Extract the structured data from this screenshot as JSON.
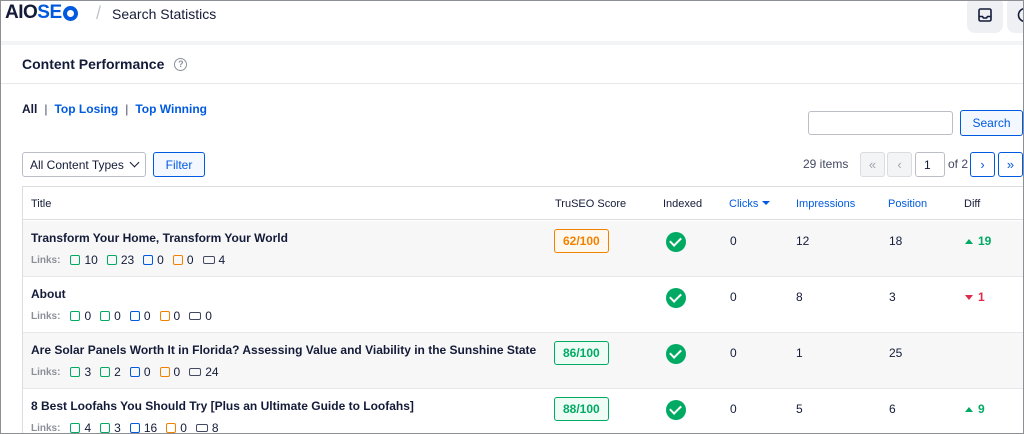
{
  "header": {
    "logo_prefix": "AIO",
    "logo_suffix": "SE",
    "separator": "/",
    "breadcrumb": "Search Statistics"
  },
  "panel": {
    "title": "Content Performance",
    "help_symbol": "?"
  },
  "filters": {
    "all": "All",
    "top_losing": "Top Losing",
    "top_winning": "Top Winning",
    "separator": "|"
  },
  "search": {
    "value": "",
    "button": "Search"
  },
  "content_type": {
    "selected": "All Content Types"
  },
  "filter_button": "Filter",
  "pagination": {
    "items": "29 items",
    "first": "«",
    "prev": "‹",
    "current_page": "1",
    "of_label": "of 2",
    "next": "›",
    "last": "»"
  },
  "table": {
    "columns": {
      "title": "Title",
      "score": "TruSEO Score",
      "indexed": "Indexed",
      "clicks": "Clicks",
      "impressions": "Impressions",
      "position": "Position",
      "diff": "Diff"
    },
    "links_label": "Links:",
    "rows": [
      {
        "title": "Transform Your Home, Transform Your World",
        "links": {
          "internal": "10",
          "outbound": "23",
          "external": "0",
          "affiliate": "0",
          "total": "4"
        },
        "score": "62/100",
        "indexed": true,
        "clicks": "0",
        "impressions": "12",
        "position": "18",
        "diff": "19",
        "diff_direction": "up"
      },
      {
        "title": "About",
        "links": {
          "internal": "0",
          "outbound": "0",
          "external": "0",
          "affiliate": "0",
          "total": "0"
        },
        "score": "",
        "indexed": true,
        "clicks": "0",
        "impressions": "8",
        "position": "3",
        "diff": "1",
        "diff_direction": "down"
      },
      {
        "title": "Are Solar Panels Worth It in Florida? Assessing Value and Viability in the Sunshine State",
        "links": {
          "internal": "3",
          "outbound": "2",
          "external": "0",
          "affiliate": "0",
          "total": "24"
        },
        "score": "86/100",
        "indexed": true,
        "clicks": "0",
        "impressions": "1",
        "position": "25",
        "diff": "",
        "diff_direction": "none"
      },
      {
        "title": "8 Best Loofahs You Should Try [Plus an Ultimate Guide to Loofahs]",
        "links": {
          "internal": "4",
          "outbound": "3",
          "external": "16",
          "affiliate": "0",
          "total": "8"
        },
        "score": "88/100",
        "indexed": true,
        "clicks": "0",
        "impressions": "5",
        "position": "6",
        "diff": "9",
        "diff_direction": "up"
      }
    ]
  },
  "colors": {
    "brand_blue": "#005ae0",
    "success_green": "#00aa63",
    "warning_orange": "#f18200",
    "danger_red": "#df2a4a"
  }
}
